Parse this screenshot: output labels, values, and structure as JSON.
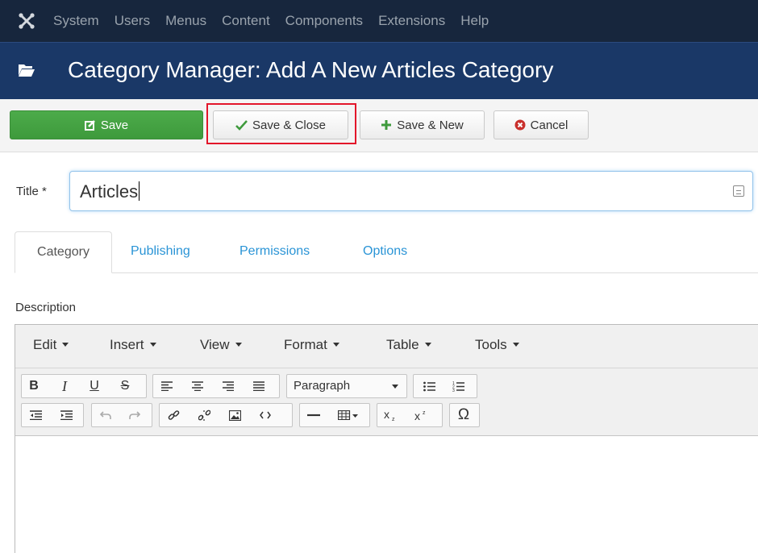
{
  "nav": {
    "items": [
      "System",
      "Users",
      "Menus",
      "Content",
      "Components",
      "Extensions",
      "Help"
    ]
  },
  "header": {
    "title": "Category Manager: Add A New Articles Category"
  },
  "toolbar": {
    "save_label": "Save",
    "save_close_label": "Save & Close",
    "save_new_label": "Save & New",
    "cancel_label": "Cancel"
  },
  "form": {
    "title_label": "Title *",
    "title_value": "Articles",
    "description_label": "Description"
  },
  "tabs": [
    "Category",
    "Publishing",
    "Permissions",
    "Options"
  ],
  "editor": {
    "menus": [
      "Edit",
      "Insert",
      "View",
      "Format",
      "Table",
      "Tools"
    ],
    "format_select": "Paragraph"
  },
  "colors": {
    "nav_bg": "#17263d",
    "title_bar_bg": "#1a3867",
    "save_green": "#46a546",
    "highlight_red": "#e3162a",
    "tab_link": "#2a94d6"
  }
}
